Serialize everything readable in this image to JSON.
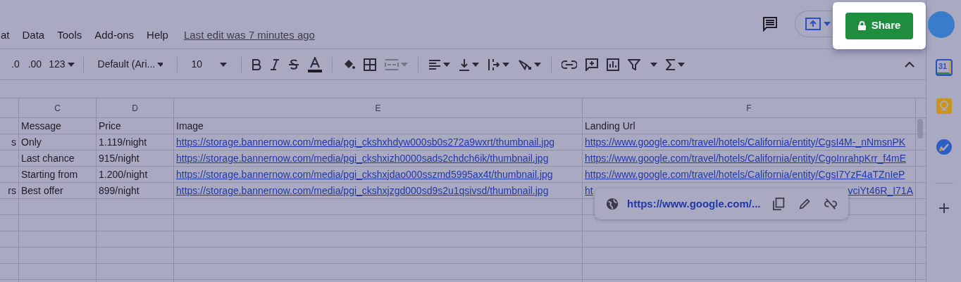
{
  "menu": [
    "at",
    "Data",
    "Tools",
    "Add-ons",
    "Help"
  ],
  "last_edit": "Last edit was 7 minutes ago",
  "share_button": "Share",
  "toolbar": {
    "decimal_decrease": ".0",
    "decimal_increase": ".00",
    "number_format": "123",
    "font": "Default (Ari...",
    "font_size": "10",
    "merge_disabled": true
  },
  "columns": [
    "",
    "C",
    "D",
    "E",
    "F"
  ],
  "rows": [
    {
      "cells": [
        "",
        "Message",
        "Price",
        "Image",
        "Landing Url"
      ],
      "links": false
    },
    {
      "cells": [
        "s",
        "Only",
        "1.119/night",
        "https://storage.bannernow.com/media/pgi_ckshxhdyw000sb0s272a9wxrt/thumbnail.jpg",
        "https://www.google.com/travel/hotels/California/entity/CgsI4M-_nNmsnPK"
      ],
      "links": true
    },
    {
      "cells": [
        "",
        "Last chance",
        "915/night",
        "https://storage.bannernow.com/media/pgi_ckshxizh0000sads2chdch6ik/thumbnail.jpg",
        "https://www.google.com/travel/hotels/California/entity/CgoInrahpKrr_f4mE"
      ],
      "links": true
    },
    {
      "cells": [
        "",
        "Starting from",
        "1.200/night",
        "https://storage.bannernow.com/media/pgi_ckshxjdao000sszmd5995ax4t/thumbnail.jpg",
        "https://www.google.com/travel/hotels/California/entity/CgsI7YzF4aTZnIeP"
      ],
      "links": true
    },
    {
      "cells": [
        "rs",
        "Best offer",
        "899/night",
        "https://storage.bannernow.com/media/pgi_ckshxjzgd000sd9s2u1qsivsd/thumbnail.jpg",
        [
          "ht",
          "vciYt46R_I71A"
        ]
      ],
      "links": true
    }
  ],
  "link_popup": {
    "url": "https://www.google.com/..."
  },
  "side_panel": {
    "calendar_label": "31"
  }
}
